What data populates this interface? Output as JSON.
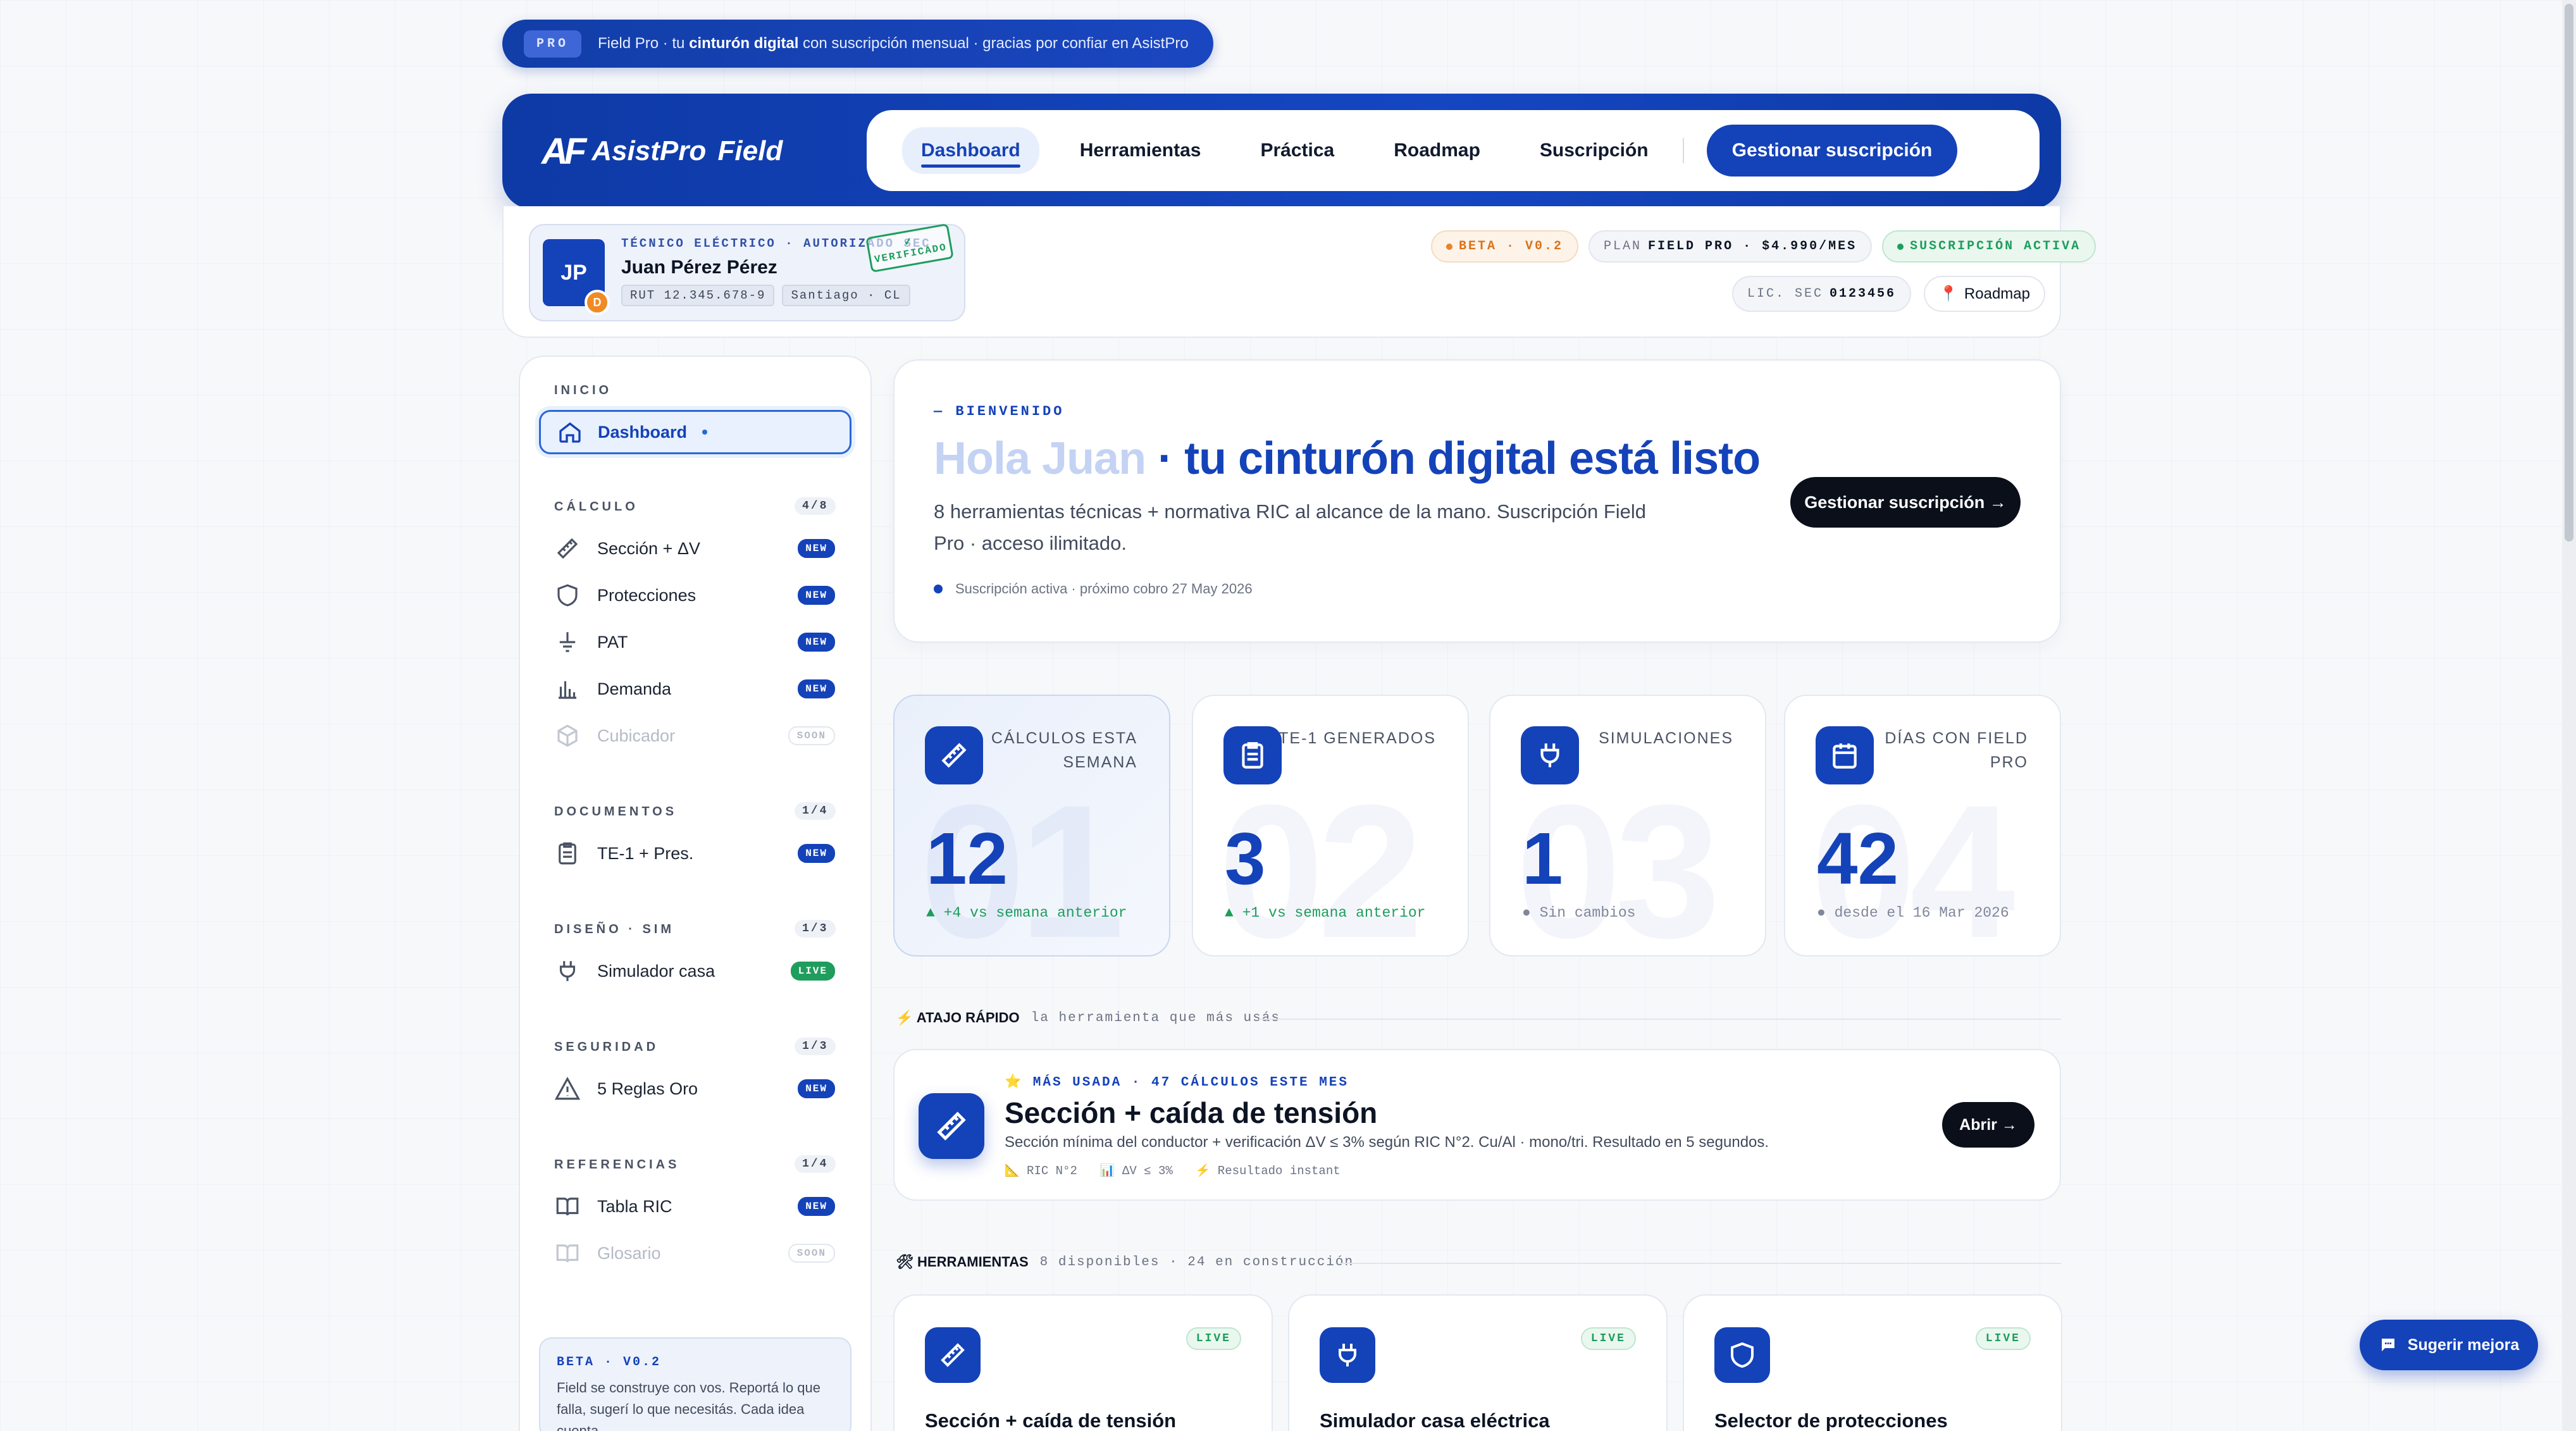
{
  "announcement": {
    "tag": "PRO",
    "prefix": "Field Pro · tu ",
    "bold": "cinturón digital",
    "suffix": " con suscripción mensual · gracias por confiar en AsistPro"
  },
  "brand": {
    "mark": "AF",
    "name": "AsistPro",
    "suffix": "Field"
  },
  "nav": {
    "items": [
      "Dashboard",
      "Herramientas",
      "Práctica",
      "Roadmap",
      "Suscripción"
    ],
    "cta": "Gestionar suscripción"
  },
  "user": {
    "initials": "JP",
    "badge": "D",
    "role": "TÉCNICO ELÉCTRICO · AUTORIZADO SEC",
    "name": "Juan Pérez Pérez",
    "rut": "RUT 12.345.678-9",
    "location": "Santiago · CL",
    "stamp_top": "✓",
    "stamp": "VERIFICADO"
  },
  "status": {
    "beta": "BETA · V0.2",
    "plan_label": "PLAN",
    "plan_value": "FIELD PRO · $4.990/MES",
    "subscription": "SUSCRIPCIÓN ACTIVA",
    "lic_label": "LIC. SEC",
    "lic_value": "0123456",
    "roadmap": "Roadmap"
  },
  "sidebar": {
    "inicio_title": "INICIO",
    "dashboard": "Dashboard",
    "sections": [
      {
        "title": "CÁLCULO",
        "count": "4/8",
        "items": [
          {
            "label": "Sección + ΔV",
            "badge": "NEW"
          },
          {
            "label": "Protecciones",
            "badge": "NEW"
          },
          {
            "label": "PAT",
            "badge": "NEW"
          },
          {
            "label": "Demanda",
            "badge": "NEW"
          },
          {
            "label": "Cubicador",
            "badge": "SOON"
          }
        ]
      },
      {
        "title": "DOCUMENTOS",
        "count": "1/4",
        "items": [
          {
            "label": "TE-1 + Pres.",
            "badge": "NEW"
          }
        ]
      },
      {
        "title": "DISEÑO · SIM",
        "count": "1/3",
        "items": [
          {
            "label": "Simulador casa",
            "badge": "LIVE"
          }
        ]
      },
      {
        "title": "SEGURIDAD",
        "count": "1/3",
        "items": [
          {
            "label": "5 Reglas Oro",
            "badge": "NEW"
          }
        ]
      },
      {
        "title": "REFERENCIAS",
        "count": "1/4",
        "items": [
          {
            "label": "Tabla RIC",
            "badge": "NEW"
          },
          {
            "label": "Glosario",
            "badge": "SOON"
          }
        ]
      }
    ],
    "beta_title": "BETA · V0.2",
    "beta_text": "Field se construye con vos. Reportá lo que falla, sugerí lo que necesitás. Cada idea cuenta."
  },
  "hero": {
    "kicker": "— BIENVENIDO",
    "title_fade": "Hola Juan",
    "title_rest": " · tu cinturón digital está listo",
    "subtitle": "8 herramientas técnicas + normativa RIC al alcance de la mano. Suscripción Field Pro · acceso ilimitado.",
    "status": "Suscripción activa · próximo cobro 27 May 2026",
    "cta": "Gestionar suscripción →"
  },
  "stats": [
    {
      "label": "CÁLCULOS ESTA SEMANA",
      "value": "12",
      "delta": "▲ +4 vs semana anterior",
      "ghost": "01"
    },
    {
      "label": "TE-1 GENERADOS",
      "value": "3",
      "delta": "▲ +1 vs semana anterior",
      "ghost": "02"
    },
    {
      "label": "SIMULACIONES",
      "value": "1",
      "delta": "● Sin cambios",
      "ghost": "03"
    },
    {
      "label": "DÍAS CON FIELD PRO",
      "value": "42",
      "delta": "● desde el 16 Mar 2026",
      "ghost": "04"
    }
  ],
  "quick": {
    "head": "⚡ ATAJO RÁPIDO",
    "head_sub": "la herramienta que más usás",
    "kicker": "⭐ MÁS USADA · 47 CÁLCULOS ESTE MES",
    "title": "Sección + caída de tensión",
    "desc": "Sección mínima del conductor + verificación ΔV ≤ 3% según RIC N°2. Cu/Al · mono/tri. Resultado en 5 segundos.",
    "tags": [
      "📐 RIC N°2",
      "📊 ΔV ≤ 3%",
      "⚡ Resultado instant"
    ],
    "open": "Abrir →"
  },
  "tools": {
    "head": "🛠 HERRAMIENTAS",
    "head_sub": "8 disponibles · 24 en construcción",
    "cards": [
      {
        "name": "Sección + caída de tensión",
        "badge": "LIVE"
      },
      {
        "name": "Simulador casa eléctrica",
        "badge": "LIVE"
      },
      {
        "name": "Selector de protecciones",
        "badge": "LIVE"
      }
    ]
  },
  "suggest": "Sugerir mejora"
}
